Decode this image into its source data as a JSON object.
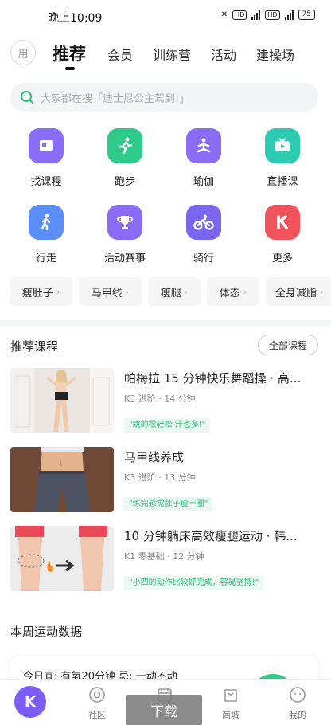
{
  "status_bar": {
    "time": "晚上10:09",
    "battery": "75",
    "hd1": "HD",
    "hd2": "HD"
  },
  "top_nav": {
    "avatar_label": "用",
    "tabs": [
      "推荐",
      "会员",
      "训练营",
      "活动",
      "建操场"
    ]
  },
  "search": {
    "placeholder": "大家都在搜「迪士尼公主驾到!」"
  },
  "grid": [
    {
      "label": "找课程",
      "icon": "course-icon",
      "color": "#8b6cf6"
    },
    {
      "label": "跑步",
      "icon": "running-icon",
      "color": "#2ecb8b"
    },
    {
      "label": "瑜伽",
      "icon": "yoga-icon",
      "color": "#8b6cf6"
    },
    {
      "label": "直播课",
      "icon": "tv-icon",
      "color": "#2ecbb3"
    },
    {
      "label": "行走",
      "icon": "walking-icon",
      "color": "#5a8df6"
    },
    {
      "label": "活动赛事",
      "icon": "trophy-icon",
      "color": "#8b6cf6"
    },
    {
      "label": "骑行",
      "icon": "cycling-icon",
      "color": "#7b66f0"
    },
    {
      "label": "更多",
      "icon": "more-icon",
      "color": "#f0545a"
    }
  ],
  "chips": [
    "瘦肚子",
    "马甲线",
    "瘦腿",
    "体态",
    "全身减脂"
  ],
  "recommend": {
    "title": "推荐课程",
    "all_button": "全部课程",
    "courses": [
      {
        "title": "帕梅拉 15 分钟快乐舞蹈操 · 高...",
        "level": "K3 进阶",
        "duration": "14 分钟",
        "tag": "\"跳的很轻松 汗也多!\""
      },
      {
        "title": "马甲线养成",
        "level": "K3 进阶",
        "duration": "13 分钟",
        "tag": "\"练完感觉肚子瘦一圈\""
      },
      {
        "title": "10 分钟躺床高效瘦腿运动 · 韩...",
        "level": "K1 零基础",
        "duration": "12 分钟",
        "tag": "\"小四的动作比较好完成，容易坚持!\""
      }
    ]
  },
  "weekly": {
    "title": "本周运动数据",
    "card_text": "今日宜: 有氧20分钟 忌: 一动不动"
  },
  "bottom_nav": {
    "logo": "K",
    "items": [
      "社区",
      "下载",
      "商城",
      "我的"
    ],
    "download_overlay": "下载"
  },
  "colors": {
    "accent": "#2bbf7e",
    "purple": "#7c5cf5"
  }
}
